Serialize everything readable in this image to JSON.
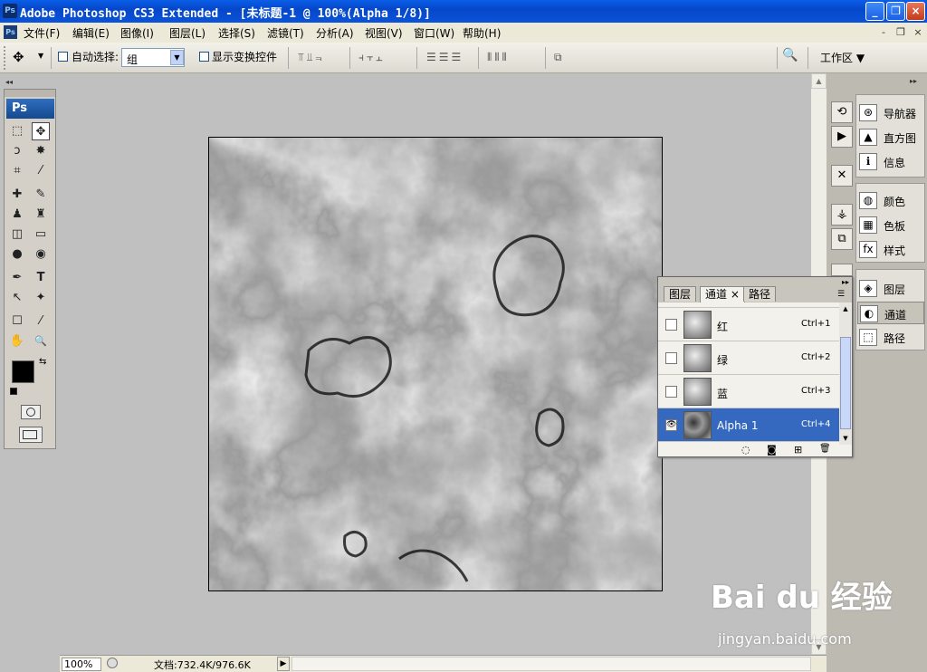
{
  "titlebar": {
    "ps_icon": "Ps",
    "title": "Adobe Photoshop CS3 Extended - [未标题-1 @ 100%(Alpha 1/8)]",
    "minimize": "_",
    "maximize": "❐",
    "close": "×"
  },
  "menubar": {
    "app_icon": "Ps",
    "items": [
      "文件(F)",
      "编辑(E)",
      "图像(I)",
      "图层(L)",
      "选择(S)",
      "滤镜(T)",
      "分析(A)",
      "视图(V)",
      "窗口(W)",
      "帮助(H)"
    ],
    "doc_min": "-",
    "doc_restore": "❐",
    "doc_close": "×"
  },
  "options": {
    "auto_select_label": "自动选择:",
    "auto_select_value": "组",
    "show_transform_label": "显示变换控件",
    "workspace_label": "工作区 ▼",
    "move_icon": "✥",
    "bridge_icon": "🔍"
  },
  "toolbox": {
    "logo": "Ps",
    "collapse": "◂◂",
    "tools": [
      "⬚",
      "✥",
      "ↄ",
      "✸",
      "⌗",
      "⁄",
      "✚",
      "✎",
      "♟",
      "♜",
      "◫",
      "▭",
      "●",
      "◉",
      "✒",
      "T",
      "↖",
      "✦",
      "☐",
      "⁄",
      "✋",
      "🔍"
    ],
    "fg_color": "#000000",
    "bg_color": "#ffffff"
  },
  "status": {
    "zoom": "100%",
    "doc_info": "文档:732.4K/976.6K",
    "arrow": "▶"
  },
  "right_panel": {
    "collapse": "▸▸",
    "group1": [
      "导航器",
      "直方图",
      "信息"
    ],
    "group2": [
      "颜色",
      "色板",
      "样式"
    ],
    "group3": [
      "图层",
      "通道",
      "路径"
    ],
    "icons1": [
      "⊛",
      "▲",
      "ℹ"
    ],
    "icons2": [
      "◍",
      "▦",
      "fx"
    ],
    "icons3": [
      "◈",
      "◐",
      "⬚"
    ]
  },
  "channels_panel": {
    "tabs": [
      "图层",
      "通道",
      "路径"
    ],
    "active_tab_close": "×",
    "rows": [
      {
        "name": "红",
        "shortcut": "Ctrl+1",
        "visible": false
      },
      {
        "name": "绿",
        "shortcut": "Ctrl+2",
        "visible": false
      },
      {
        "name": "蓝",
        "shortcut": "Ctrl+3",
        "visible": false
      },
      {
        "name": "Alpha 1",
        "shortcut": "Ctrl+4",
        "visible": true
      }
    ],
    "footer_icons": [
      "◌",
      "◙",
      "⊞",
      "🗑"
    ]
  },
  "watermark": {
    "logo": "Bai du 经验",
    "url": "jingyan.baidu.com"
  },
  "colors": {
    "title_blue": "#0647c9",
    "selection_blue": "#3469bf",
    "canvas_gray": "#c0c0c0"
  }
}
